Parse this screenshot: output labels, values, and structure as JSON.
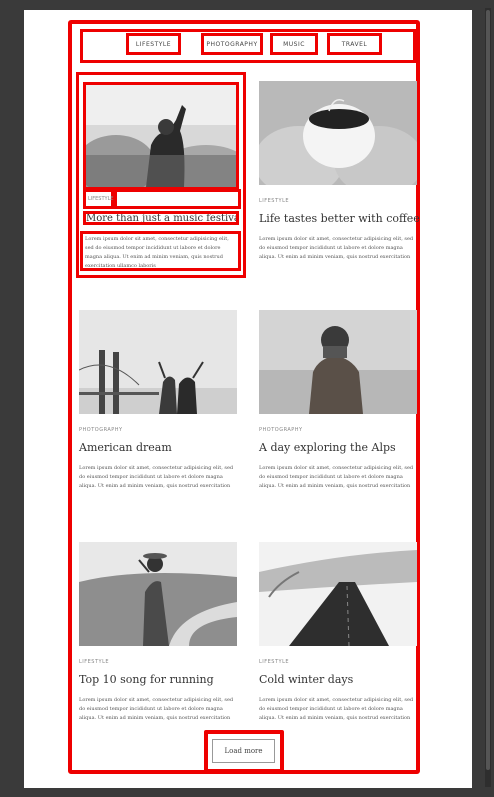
{
  "nav": {
    "items": [
      {
        "label": "LIFESTYLE"
      },
      {
        "label": "PHOTOGRAPHY"
      },
      {
        "label": "MUSIC"
      },
      {
        "label": "TRAVEL"
      }
    ]
  },
  "posts": [
    {
      "category": "LIFESTYLE",
      "title": "More than just a music festival",
      "excerpt": "Lorem ipsum dolor sit amet, consectetur adipisicing elit, sed do eiusmod tempor incididunt ut labore et dolore magna aliqua. Ut enim ad minim veniam, quis nostrud exercitation ullamco laboris"
    },
    {
      "category": "LIFESTYLE",
      "title": "Life tastes better with coffee",
      "excerpt": "Lorem ipsum dolor sit amet, consectetur adipisicing elit, sed do eiusmod tempor incididunt ut labore et dolore magna aliqua. Ut enim ad minim veniam, quis nostrud exercitation ullamco laboris"
    },
    {
      "category": "PHOTOGRAPHY",
      "title": "American dream",
      "excerpt": "Lorem ipsum dolor sit amet, consectetur adipisicing elit, sed do eiusmod tempor incididunt ut labore et dolore magna aliqua. Ut enim ad minim veniam, quis nostrud exercitation ullamco laboris"
    },
    {
      "category": "PHOTOGRAPHY",
      "title": "A day exploring the Alps",
      "excerpt": "Lorem ipsum dolor sit amet, consectetur adipisicing elit, sed do eiusmod tempor incididunt ut labore et dolore magna aliqua. Ut enim ad minim veniam, quis nostrud exercitation ullamco laboris"
    },
    {
      "category": "LIFESTYLE",
      "title": "Top 10 song for running",
      "excerpt": "Lorem ipsum dolor sit amet, consectetur adipisicing elit, sed do eiusmod tempor incididunt ut labore et dolore magna aliqua. Ut enim ad minim veniam, quis nostrud exercitation ullamco laboris"
    },
    {
      "category": "LIFESTYLE",
      "title": "Cold winter days",
      "excerpt": "Lorem ipsum dolor sit amet, consectetur adipisicing elit, sed do eiusmod tempor incididunt ut labore et dolore magna aliqua. Ut enim ad minim veniam, quis nostrud exercitation ullamco laboris"
    }
  ],
  "load_more_label": "Load more",
  "colors": {
    "highlight": "#ee0000",
    "background": "#3a3a3a",
    "page": "#ffffff"
  }
}
